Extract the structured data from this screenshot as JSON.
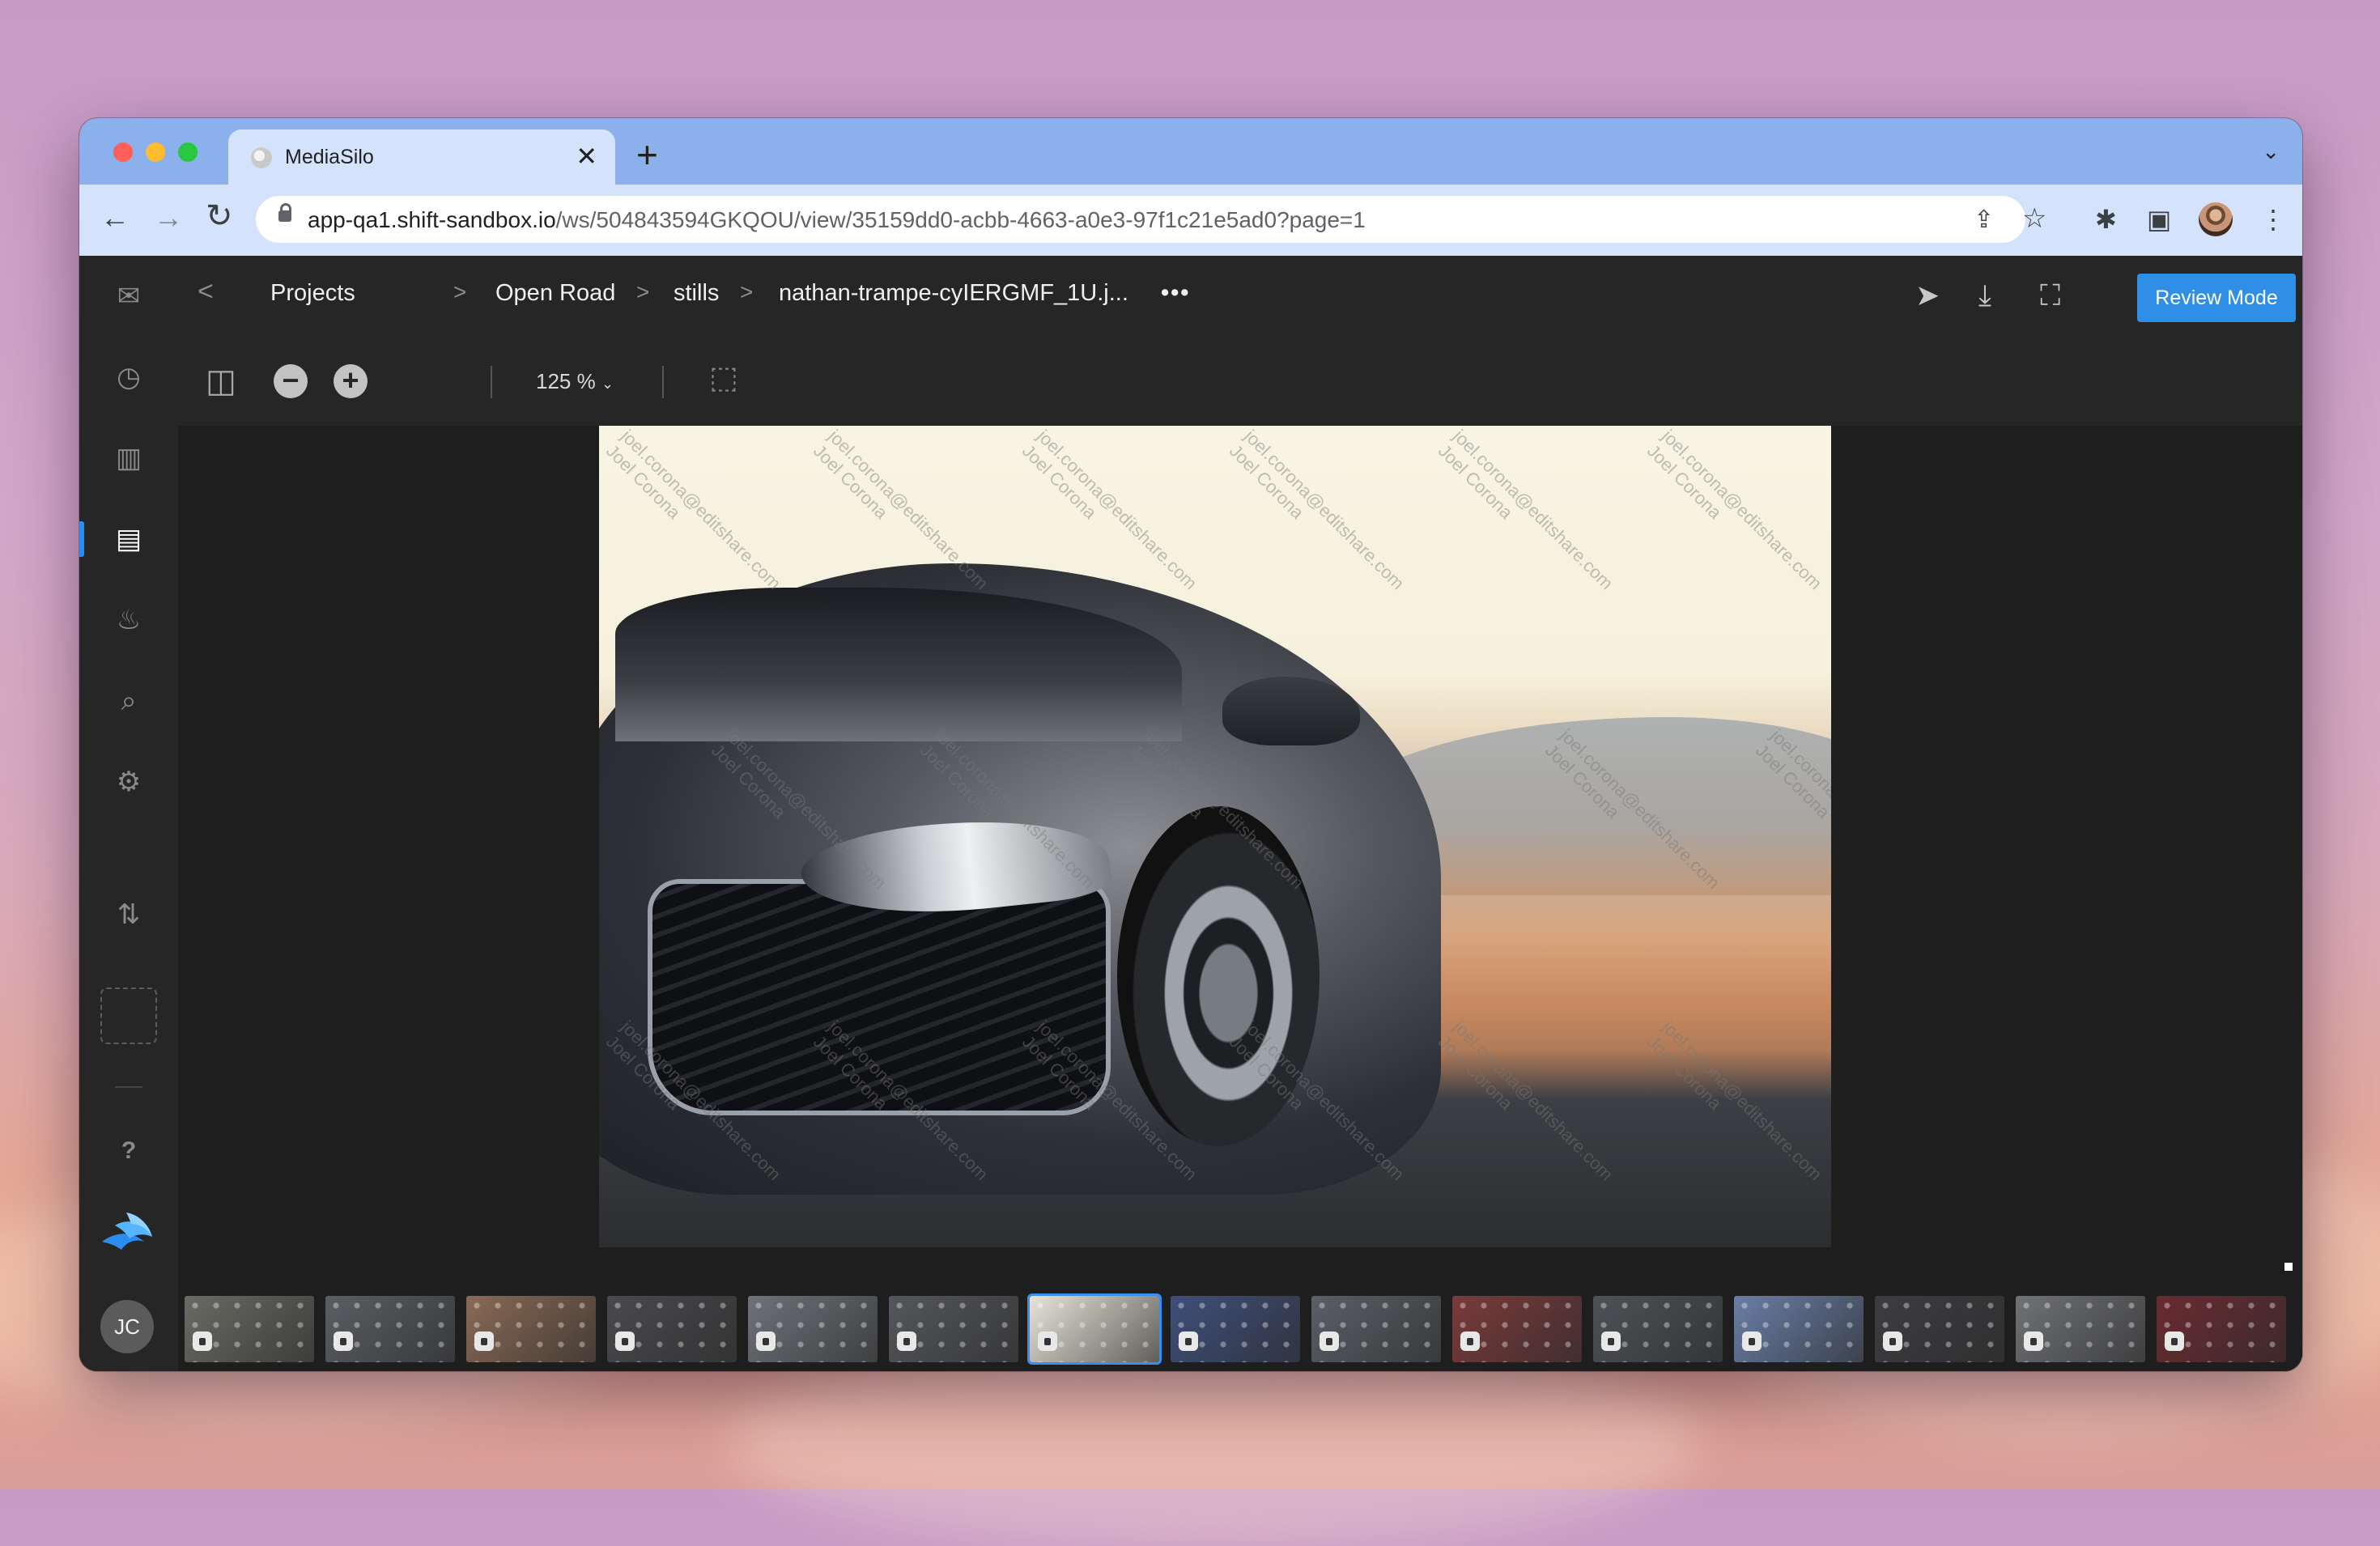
{
  "browser": {
    "tab_title": "MediaSilo",
    "tab_close": "✕",
    "new_tab": "+",
    "tab_menu": "⌄",
    "url_host": "app-qa1.shift-sandbox.io",
    "url_path": "/ws/504843594GKQOU/view/35159dd0-acbb-4663-a0e3-97f1c21e5ad0?page=1",
    "nav_back": "←",
    "nav_forward": "→",
    "nav_reload": "↻",
    "share_icon_glyph": "⇪",
    "star_icon_glyph": "☆",
    "extensions_icon_glyph": "✱",
    "sidepanel_icon_glyph": "▣",
    "menu_icon_glyph": "⋮",
    "accent_color": "#8bb0ec"
  },
  "app": {
    "breadcrumbs": [
      "Projects",
      "Open Road",
      "stills",
      "nathan-trampe-cyIERGMF_1U.j..."
    ],
    "breadcrumb_sep": ">",
    "back_chevron": "<",
    "more": "•••",
    "review_button": "Review Mode",
    "review_color": "#2f8ee6",
    "zoom_value": "125 %",
    "zoom_minus": "−",
    "zoom_plus": "+",
    "user_initials": "JC",
    "icons": {
      "send": "➤",
      "download": "⤓",
      "fullscreen": "⛶",
      "collapse": "⇤",
      "sidebar_toggle": "◫",
      "selection": "⬚"
    }
  },
  "leftnav": {
    "items": [
      {
        "name": "inbox-icon",
        "glyph": "✉"
      },
      {
        "name": "recent-icon",
        "glyph": "◷"
      },
      {
        "name": "analytics-icon",
        "glyph": "▥"
      },
      {
        "name": "projects-icon",
        "glyph": "▤"
      },
      {
        "name": "trending-icon",
        "glyph": "♨"
      },
      {
        "name": "search-icon",
        "glyph": "⌕"
      },
      {
        "name": "gear-icon",
        "glyph": "⚙"
      },
      {
        "name": "transfer-icon",
        "glyph": "⇅"
      },
      {
        "name": "help-icon",
        "glyph": "?"
      }
    ]
  },
  "watermark": {
    "email": "joel.corona@editshare.com",
    "name": "Joel Corona"
  },
  "filmstrip": {
    "count": 15,
    "selected_index": 6,
    "thumb_colors": [
      "#6b6a64",
      "#5b5e63",
      "#8a6a55",
      "#4a4a4e",
      "#6e7379",
      "#55575c",
      "#e8e4d8",
      "#3f4f7a",
      "#5b5f66",
      "#7b3a3a",
      "#4e5156",
      "#6a7ea6",
      "#3d3d41",
      "#707275",
      "#6a2b30"
    ]
  }
}
